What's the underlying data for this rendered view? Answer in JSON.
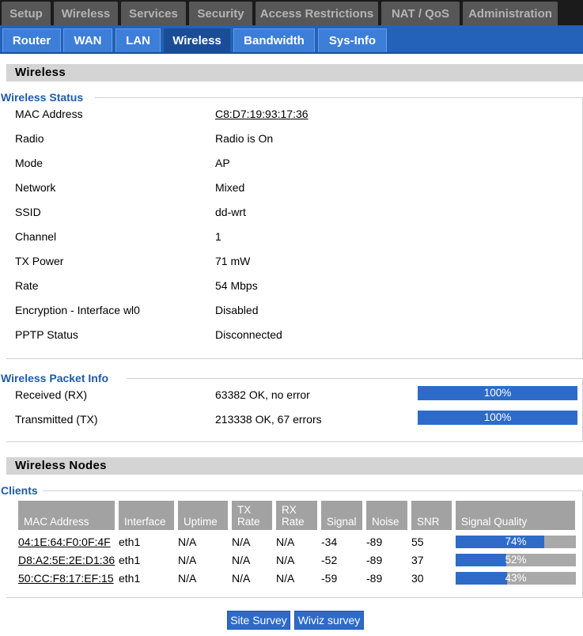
{
  "top_tabs": [
    "Setup",
    "Wireless",
    "Services",
    "Security",
    "Access Restrictions",
    "NAT / QoS",
    "Administration"
  ],
  "sub_tabs": [
    "Router",
    "WAN",
    "LAN",
    "Wireless",
    "Bandwidth",
    "Sys-Info"
  ],
  "active_sub_tab": "Wireless",
  "section_title": "Wireless",
  "wireless_status": {
    "legend": "Wireless Status",
    "rows": [
      {
        "label": "MAC Address",
        "value": "C8:D7:19:93:17:36"
      },
      {
        "label": "Radio",
        "value": "Radio is On"
      },
      {
        "label": "Mode",
        "value": "AP"
      },
      {
        "label": "Network",
        "value": "Mixed"
      },
      {
        "label": "SSID",
        "value": "dd-wrt"
      },
      {
        "label": "Channel",
        "value": "1"
      },
      {
        "label": "TX Power",
        "value": "71 mW"
      },
      {
        "label": "Rate",
        "value": "54 Mbps"
      },
      {
        "label": "Encryption - Interface wl0",
        "value": "Disabled"
      },
      {
        "label": "PPTP Status",
        "value": "Disconnected"
      }
    ]
  },
  "packet_info": {
    "legend": "Wireless Packet Info",
    "rows": [
      {
        "label": "Received (RX)",
        "value": "63382 OK, no error",
        "percent_text": "100%",
        "percent": 100
      },
      {
        "label": "Transmitted (TX)",
        "value": "213338 OK, 67 errors",
        "percent_text": "100%",
        "percent": 100
      }
    ]
  },
  "nodes_title": "Wireless Nodes",
  "clients": {
    "legend": "Clients",
    "headers": [
      "MAC Address",
      "Interface",
      "Uptime",
      "TX Rate",
      "RX Rate",
      "Signal",
      "Noise",
      "SNR",
      "Signal Quality"
    ],
    "rows": [
      {
        "mac": "04:1E:64:F0:0F:4F",
        "iface": "eth1",
        "uptime": "N/A",
        "tx": "N/A",
        "rx": "N/A",
        "signal": "-34",
        "noise": "-89",
        "snr": "55",
        "quality_text": "74%",
        "quality": 74
      },
      {
        "mac": "D8:A2:5E:2E:D1:36",
        "iface": "eth1",
        "uptime": "N/A",
        "tx": "N/A",
        "rx": "N/A",
        "signal": "-52",
        "noise": "-89",
        "snr": "37",
        "quality_text": "52%",
        "quality": 42
      },
      {
        "mac": "50:CC:F8:17:EF:15",
        "iface": "eth1",
        "uptime": "N/A",
        "tx": "N/A",
        "rx": "N/A",
        "signal": "-59",
        "noise": "-89",
        "snr": "30",
        "quality_text": "43%",
        "quality": 43
      }
    ]
  },
  "buttons": {
    "site_survey": "Site Survey",
    "wiviz_survey": "Wiviz survey"
  },
  "colors": {
    "accent": "#2362b8",
    "bar_fill": "#2e6bc9",
    "bar_bg": "#a9a9a9",
    "legend": "#1f5ba8"
  }
}
